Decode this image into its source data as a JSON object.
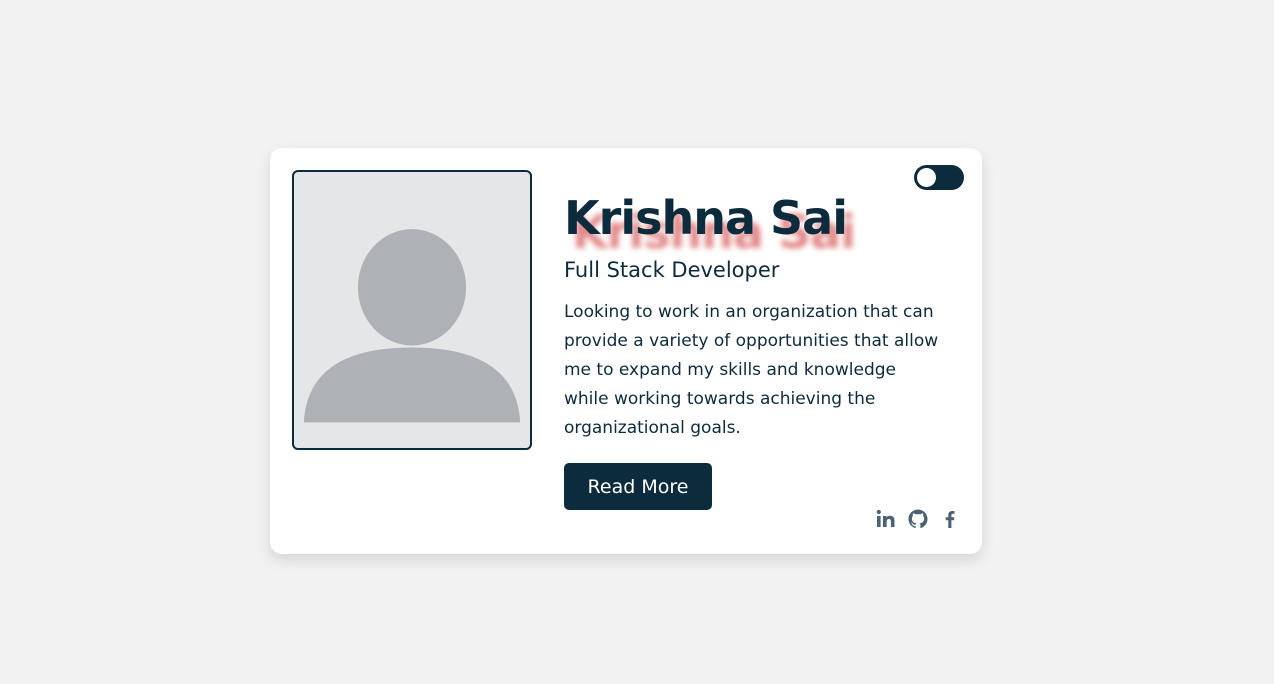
{
  "profile": {
    "name": "Krishna Sai",
    "title": "Full Stack Developer",
    "bio": "Looking to work in an organization that can provide a variety of opportunities that allow me to expand my skills and knowledge while working towards achieving the organizational goals.",
    "read_more_label": "Read More"
  },
  "theme_toggle": {
    "icon": "toggle-switch",
    "state": "off"
  },
  "photo": {
    "icon": "user-placeholder"
  },
  "socials": [
    {
      "icon": "linkedin-icon"
    },
    {
      "icon": "github-icon"
    },
    {
      "icon": "facebook-icon"
    }
  ],
  "colors": {
    "primary": "#0c2b3d",
    "background": "#f2f2f2",
    "card": "#ffffff",
    "name_shadow": "#d24646",
    "social_icon": "#4a6274"
  }
}
